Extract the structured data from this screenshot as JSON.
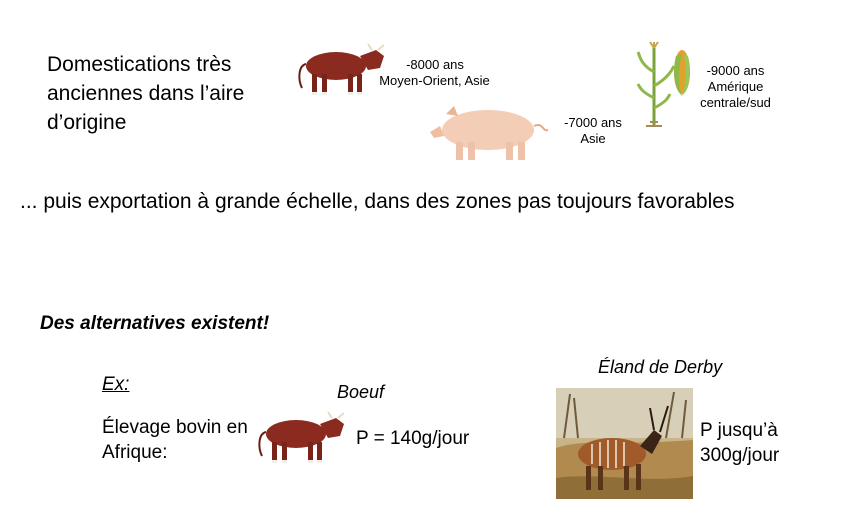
{
  "intro": {
    "title": "Domestications très anciennes dans l’aire d’origine",
    "cow": {
      "years": "-8000 ans",
      "region": "Moyen-Orient, Asie"
    },
    "pig": {
      "years": "-7000 ans",
      "region": "Asie"
    },
    "maize": {
      "years": "-9000 ans",
      "region_line1": "Amérique",
      "region_line2": "centrale/sud"
    }
  },
  "export_text": "... puis exportation à grande échelle, dans des zones pas toujours favorables",
  "alternatives": {
    "heading": "Des alternatives existent!",
    "example_label": "Ex:",
    "farming": "Élevage bovin en Afrique:",
    "beef": {
      "label": "Boeuf",
      "production": "P = 140g/jour"
    },
    "eland": {
      "label": "Éland de Derby",
      "production_line1": "P jusqu’à",
      "production_line2": "300g/jour"
    }
  },
  "icons": {
    "cow_top": "cow-image",
    "pig": "pig-image",
    "maize": "maize-plant-image",
    "cow_bottom": "cow-image",
    "eland": "eland-photo"
  },
  "colors": {
    "cow_coat": "#8b2a1f",
    "pig_skin": "#f3cdb6",
    "maize_leaf": "#8fb84a",
    "maize_cob": "#e0a22a",
    "savanna": "#b08a4e"
  }
}
